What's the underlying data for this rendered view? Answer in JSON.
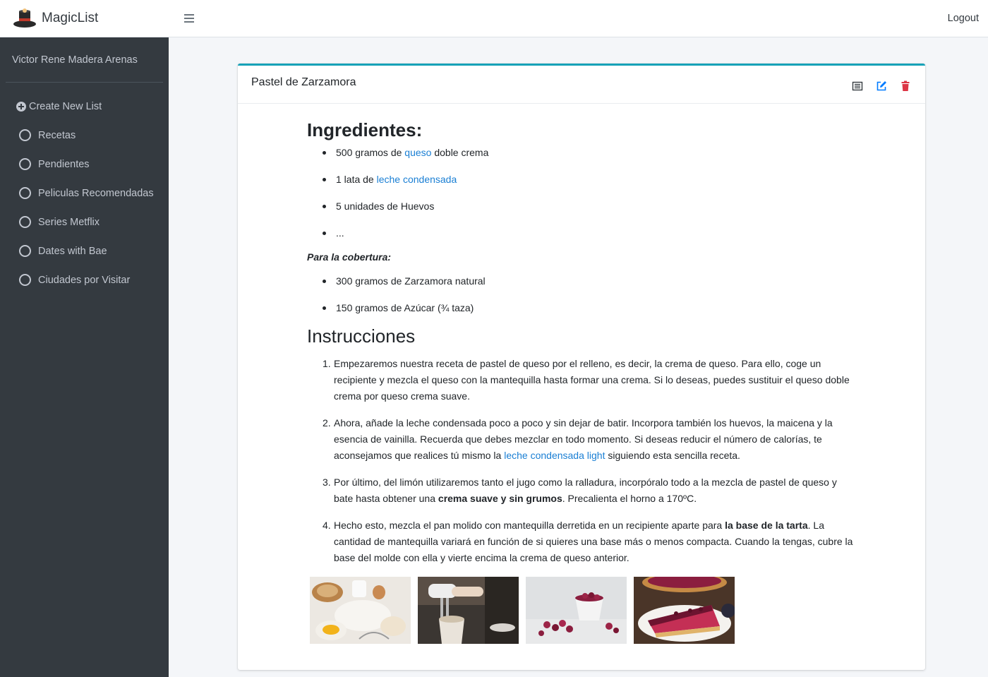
{
  "brand": {
    "name": "MagicList",
    "logo_icon": "magic-hat-icon"
  },
  "user": {
    "name": "Victor Rene Madera Arenas"
  },
  "sidebar": {
    "create_label": "Create New List",
    "items": [
      {
        "label": "Recetas"
      },
      {
        "label": "Pendientes"
      },
      {
        "label": "Peliculas Recomendadas"
      },
      {
        "label": "Series Metflix"
      },
      {
        "label": "Dates with Bae"
      },
      {
        "label": "Ciudades por Visitar"
      }
    ]
  },
  "topbar": {
    "logout_label": "Logout",
    "menu_icon": "hamburger-icon"
  },
  "colors": {
    "accent": "#17a2b8",
    "sidebar_bg": "#343a40",
    "link": "#1a7fd4",
    "edit": "#007bff",
    "delete": "#dc3545"
  },
  "card": {
    "title": "Pastel de Zarzamora",
    "tools": {
      "view_icon": "list-icon",
      "edit_icon": "edit-icon",
      "delete_icon": "trash-icon"
    },
    "ingredients_heading": "Ingredientes:",
    "ingredients": [
      {
        "before": "500 gramos de ",
        "link": "queso",
        "after": " doble crema"
      },
      {
        "before": "1 lata de ",
        "link": "leche condensada",
        "after": ""
      },
      {
        "before": "5 unidades de Huevos",
        "link": "",
        "after": ""
      },
      {
        "before": "...",
        "link": "",
        "after": ""
      }
    ],
    "topping_heading": "Para la cobertura:",
    "topping": [
      "300 gramos de Zarzamora natural",
      "150 gramos de Azúcar (¾ taza)"
    ],
    "instructions_heading": "Instrucciones",
    "steps": [
      {
        "num": "1.",
        "text": "Empezaremos nuestra receta de pastel de queso por el relleno, es decir, la crema de queso. Para ello, coge un recipiente y mezcla el queso con la mantequilla hasta formar una crema. Si lo deseas, puedes sustituir el queso doble crema por queso crema suave."
      },
      {
        "num": "2.",
        "text_a": "Ahora, añade la leche condensada poco a poco y sin dejar de batir. Incorpora también los huevos, la maicena y la esencia de vainilla. Recuerda que debes mezclar en todo momento. Si deseas reducir el número de calorías, te aconsejamos que realices tú mismo la ",
        "link": "leche condensada light",
        "text_b": " siguiendo esta sencilla receta."
      },
      {
        "num": "3.",
        "text_a": "Por último, del limón utilizaremos tanto el jugo como la ralladura, incorpóralo todo a la mezcla de pastel de queso y bate hasta obtener una ",
        "bold": "crema suave y sin grumos",
        "text_b": ". Precalienta el horno a 170ºC."
      },
      {
        "num": "4.",
        "text_a": "Hecho esto, mezcla el pan molido con mantequilla derretida en un recipiente aparte para ",
        "bold": "la base de la tarta",
        "text_b": ". La cantidad de mantequilla variará en función de si quieres una base más o menos compacta. Cuando la tengas, cubre la base del molde con ella y vierte encima la crema de queso anterior."
      }
    ],
    "photos": [
      {
        "icon": "baking-ingredients-photo"
      },
      {
        "icon": "hand-mixer-photo"
      },
      {
        "icon": "blackberries-photo"
      },
      {
        "icon": "blackberry-cheesecake-photo"
      }
    ]
  }
}
